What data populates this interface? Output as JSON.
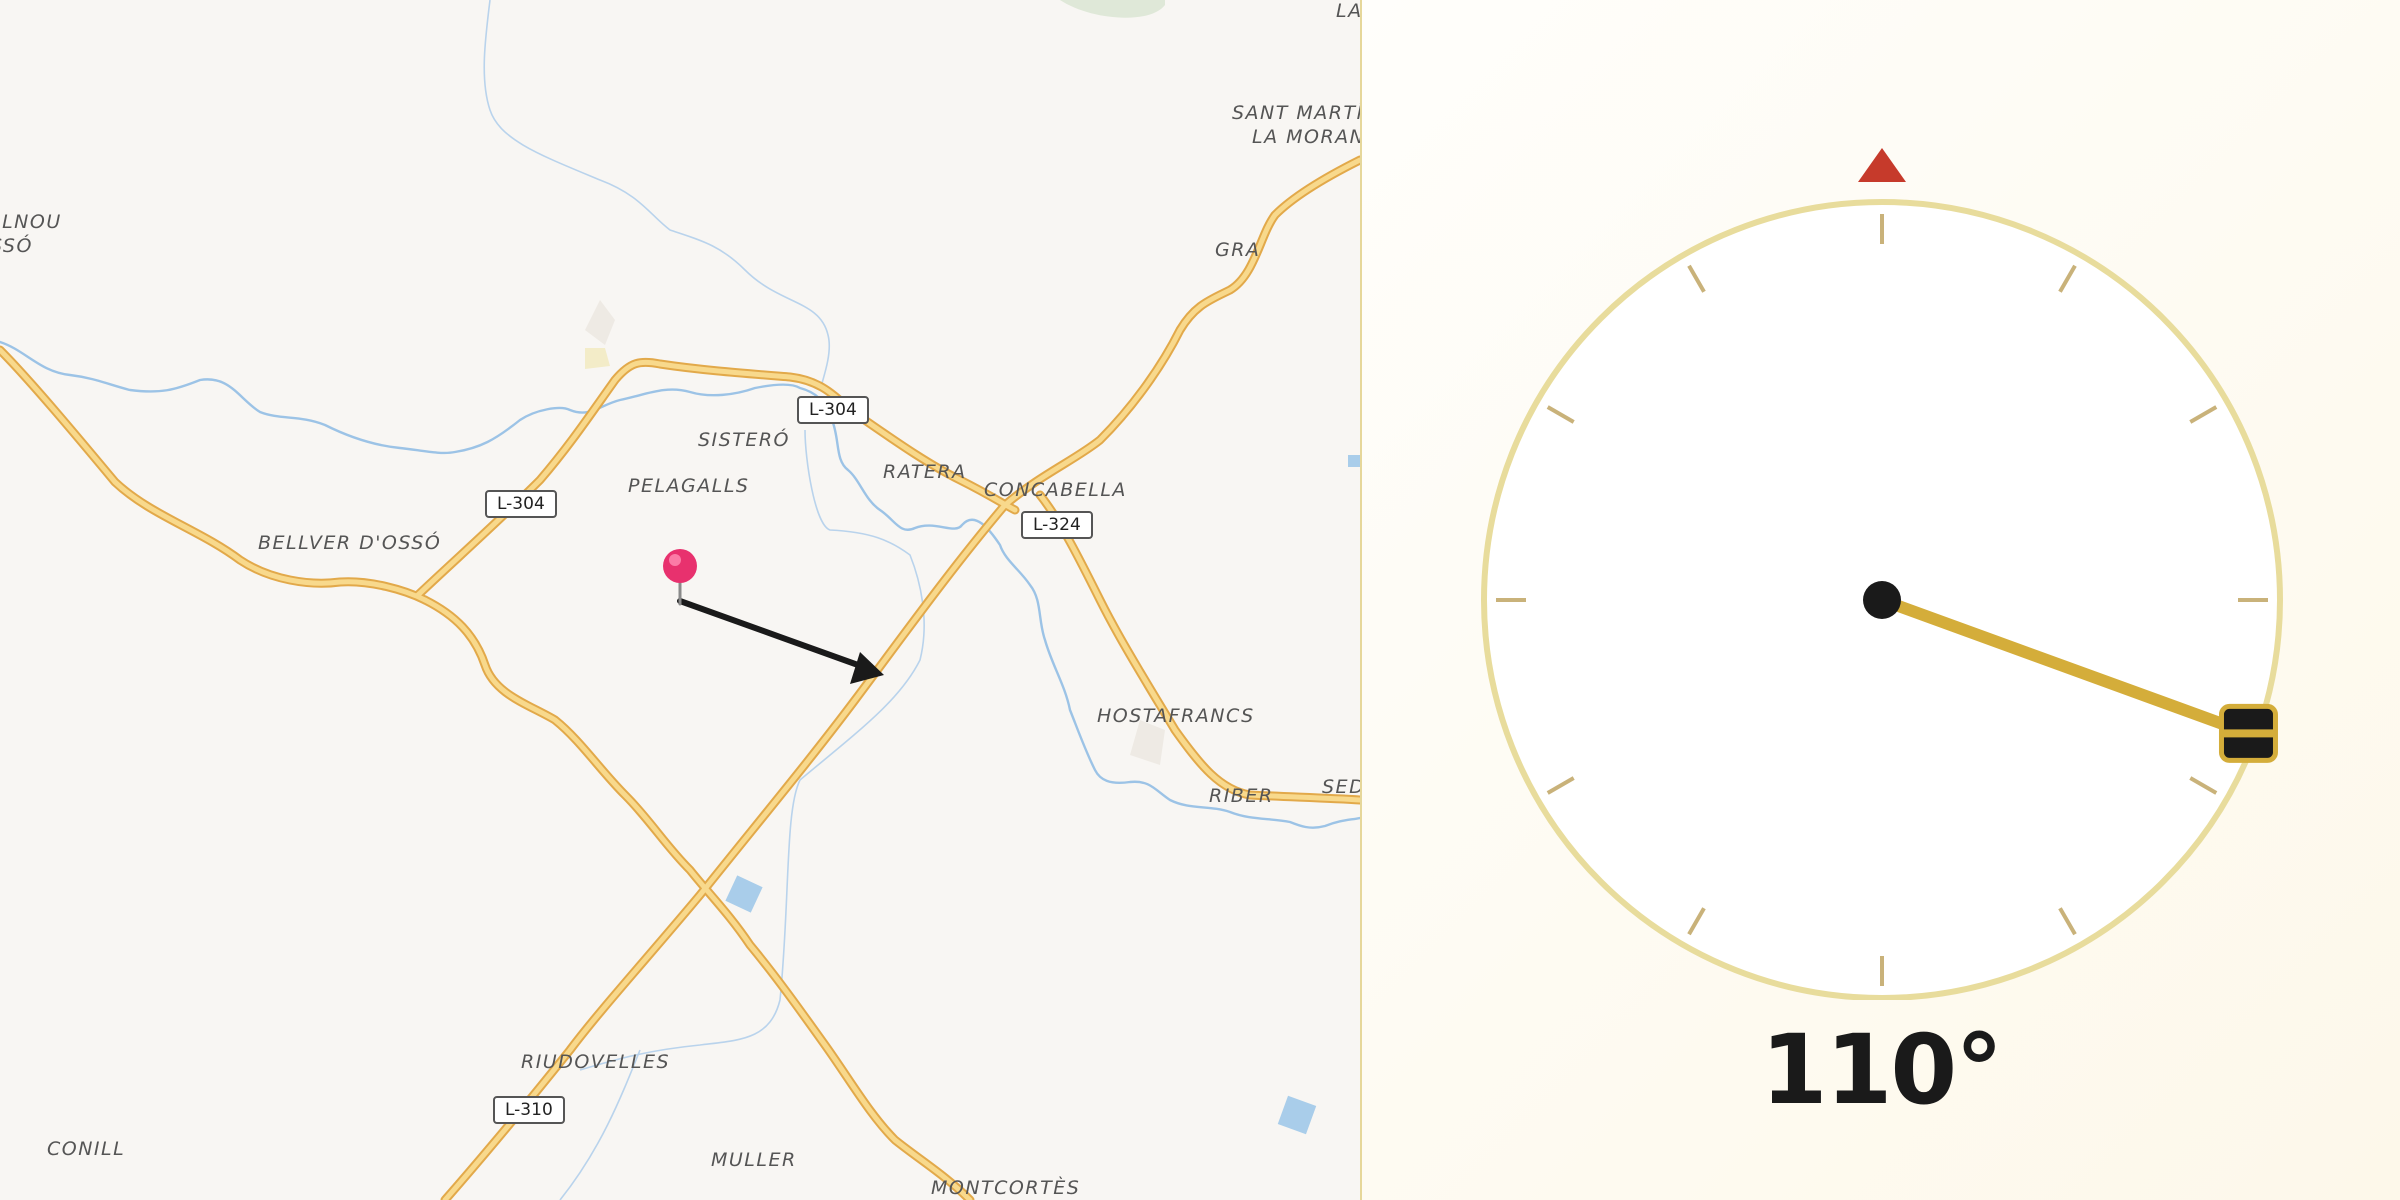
{
  "map": {
    "places": [
      {
        "id": "la",
        "text": "LA"
      },
      {
        "id": "sant-marti-1",
        "text": "SANT MARTÍ"
      },
      {
        "id": "sant-marti-2",
        "text": "LA MORAN"
      },
      {
        "id": "llnou-1",
        "text": "LLNOU"
      },
      {
        "id": "llnou-2",
        "text": "SSÓ"
      },
      {
        "id": "gra",
        "text": "GRA"
      },
      {
        "id": "sistero",
        "text": "SISTERÓ"
      },
      {
        "id": "pelagalls",
        "text": "PELAGALLS"
      },
      {
        "id": "ratera",
        "text": "RATERA"
      },
      {
        "id": "concabella",
        "text": "CONCABELLA"
      },
      {
        "id": "bellver",
        "text": "BELLVER D'OSSÓ"
      },
      {
        "id": "hostafrancs",
        "text": "HOSTAFRANCS"
      },
      {
        "id": "riber",
        "text": "RIBER"
      },
      {
        "id": "sed",
        "text": "SED"
      },
      {
        "id": "riudovelles",
        "text": "RIUDOVELLES"
      },
      {
        "id": "conill",
        "text": "CONILL"
      },
      {
        "id": "muller",
        "text": "MULLER"
      },
      {
        "id": "montcortes",
        "text": "MONTCORTÈS"
      }
    ],
    "road_shields": [
      {
        "id": "l304-a",
        "text": "L-304"
      },
      {
        "id": "l304-b",
        "text": "L-304"
      },
      {
        "id": "l324",
        "text": "L-324"
      },
      {
        "id": "l310",
        "text": "L-310"
      }
    ],
    "colors": {
      "road": "#f5c86a",
      "road_edge": "#e8b24e",
      "water": "#a9cdea",
      "pin": "#e8316e",
      "arrow": "#1a1a1a"
    }
  },
  "compass": {
    "heading_deg": 110,
    "heading_label": "110°",
    "colors": {
      "ring": "#e8dc9c",
      "needle": "#d4ad3a",
      "north_marker": "#c63a2b",
      "hub": "#1a1a1a",
      "ticks": "#c9b27a"
    }
  }
}
